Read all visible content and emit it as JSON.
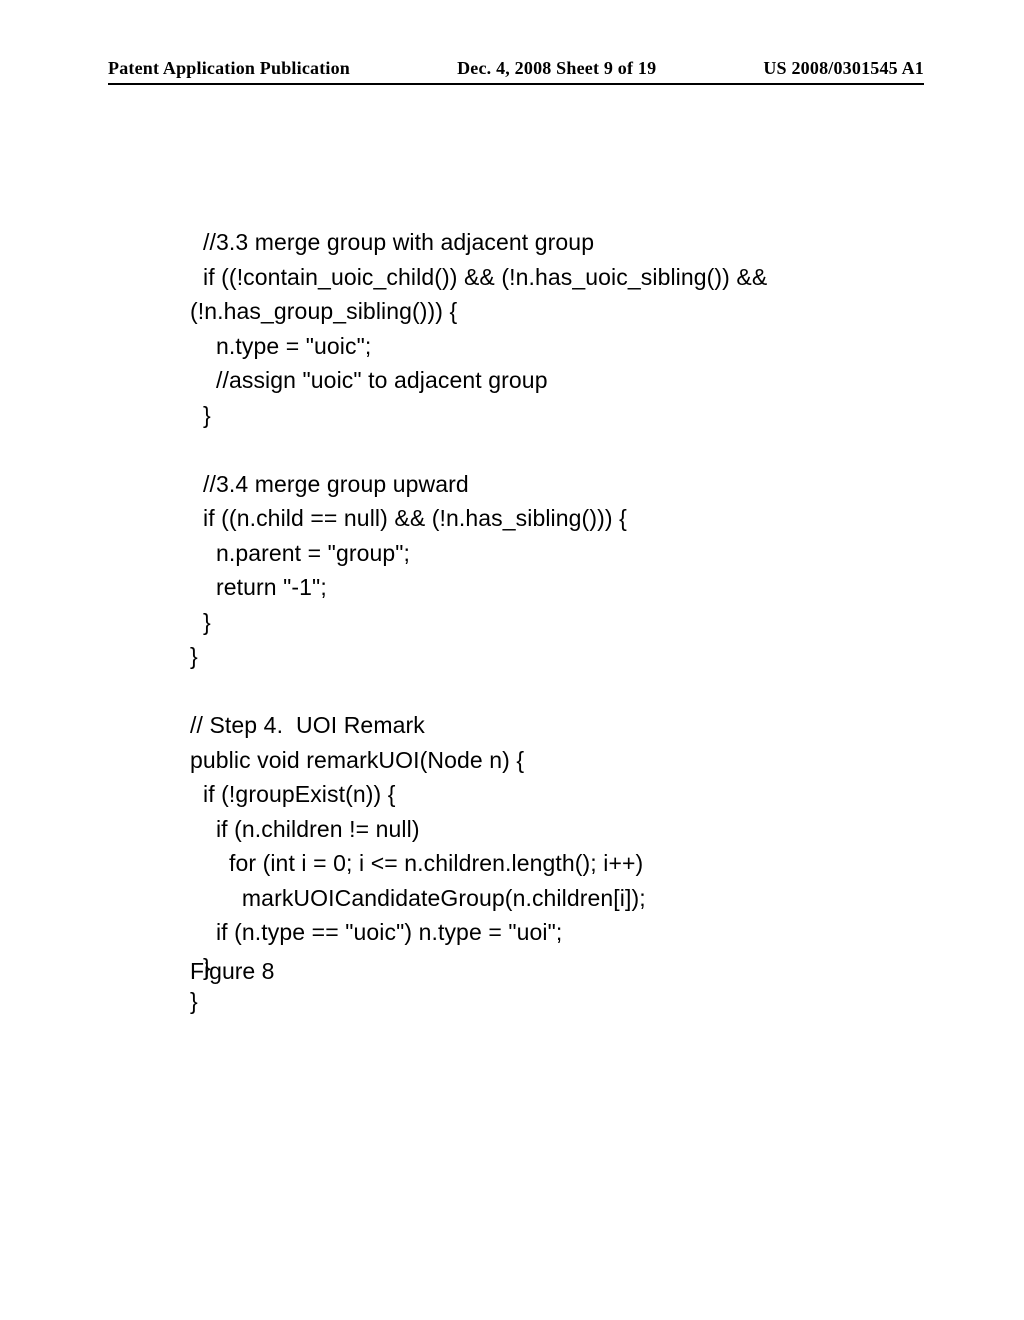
{
  "header": {
    "left": "Patent Application Publication",
    "center": "Dec. 4, 2008  Sheet 9 of 19",
    "right": "US 2008/0301545 A1"
  },
  "code": {
    "lines": [
      "  //3.3 merge group with adjacent group",
      "  if ((!contain_uoic_child()) && (!n.has_uoic_sibling()) &&",
      "(!n.has_group_sibling())) {",
      "    n.type = \"uoic\";",
      "    //assign \"uoic\" to adjacent group",
      "  }",
      "",
      "  //3.4 merge group upward",
      "  if ((n.child == null) && (!n.has_sibling())) {",
      "    n.parent = \"group\";",
      "    return \"-1\";",
      "  }",
      "}",
      "",
      "// Step 4.  UOI Remark",
      "public void remarkUOI(Node n) {",
      "  if (!groupExist(n)) {",
      "    if (n.children != null)",
      "      for (int i = 0; i <= n.children.length(); i++)",
      "        markUOICandidateGroup(n.children[i]);",
      "    if (n.type == \"uoic\") n.type = \"uoi\";",
      "  }",
      "}"
    ]
  },
  "figure_label": "Figure 8"
}
